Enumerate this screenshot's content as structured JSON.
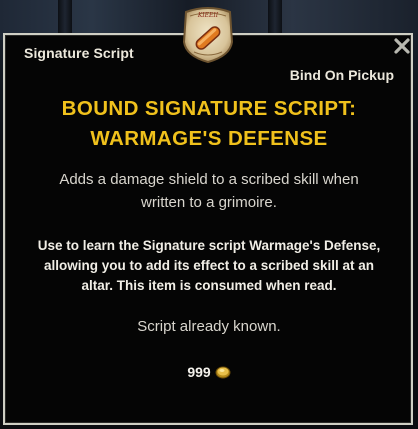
{
  "tooltip": {
    "item_type": "Signature Script",
    "bind": "Bind On Pickup",
    "title_line1": "BOUND SIGNATURE SCRIPT:",
    "title_line2": "WARMAGE'S DEFENSE",
    "description_line1": "Adds a damage shield to a scribed skill when",
    "description_line2": "written to a grimoire.",
    "use_line1": "Use to learn the Signature script Warmage's Defense,",
    "use_line2": "allowing you to add its effect to a scribed skill at an",
    "use_line3": "altar. This item is consumed when read.",
    "status": "Script already known.",
    "price": "999",
    "icon": "scroll-icon",
    "currency_icon": "gold-coin-icon",
    "close_icon": "close-icon"
  },
  "colors": {
    "title": "#f0c11c",
    "text": "#d9d6ce",
    "border": "#cfcfc4",
    "background": "#050505"
  }
}
